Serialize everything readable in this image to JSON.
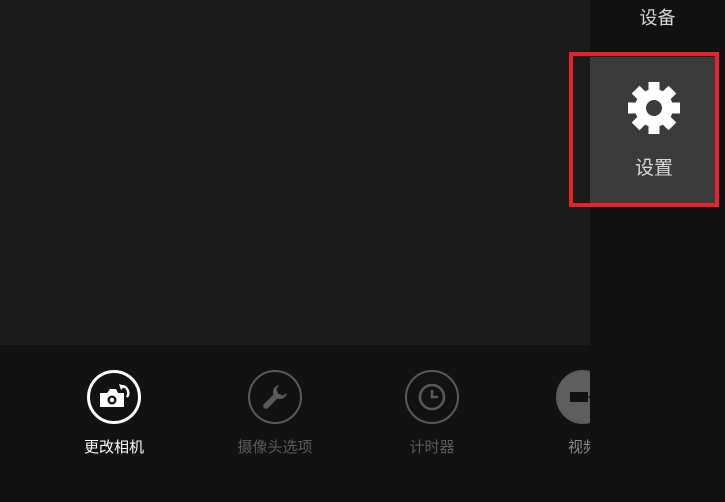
{
  "app_bar": {
    "commands": [
      {
        "label": "更改相机",
        "icon": "camera-switch-icon"
      },
      {
        "label": "摄像头选项",
        "icon": "wrench-icon"
      },
      {
        "label": "计时器",
        "icon": "clock-icon"
      },
      {
        "label": "视频",
        "icon": "video-icon"
      }
    ]
  },
  "charm": {
    "title": "设备",
    "settings_label": "设置",
    "settings_icon": "gear-icon"
  },
  "colors": {
    "highlight": "#e8222b",
    "active": "#ffffff",
    "disabled": "#5a5a5a"
  }
}
